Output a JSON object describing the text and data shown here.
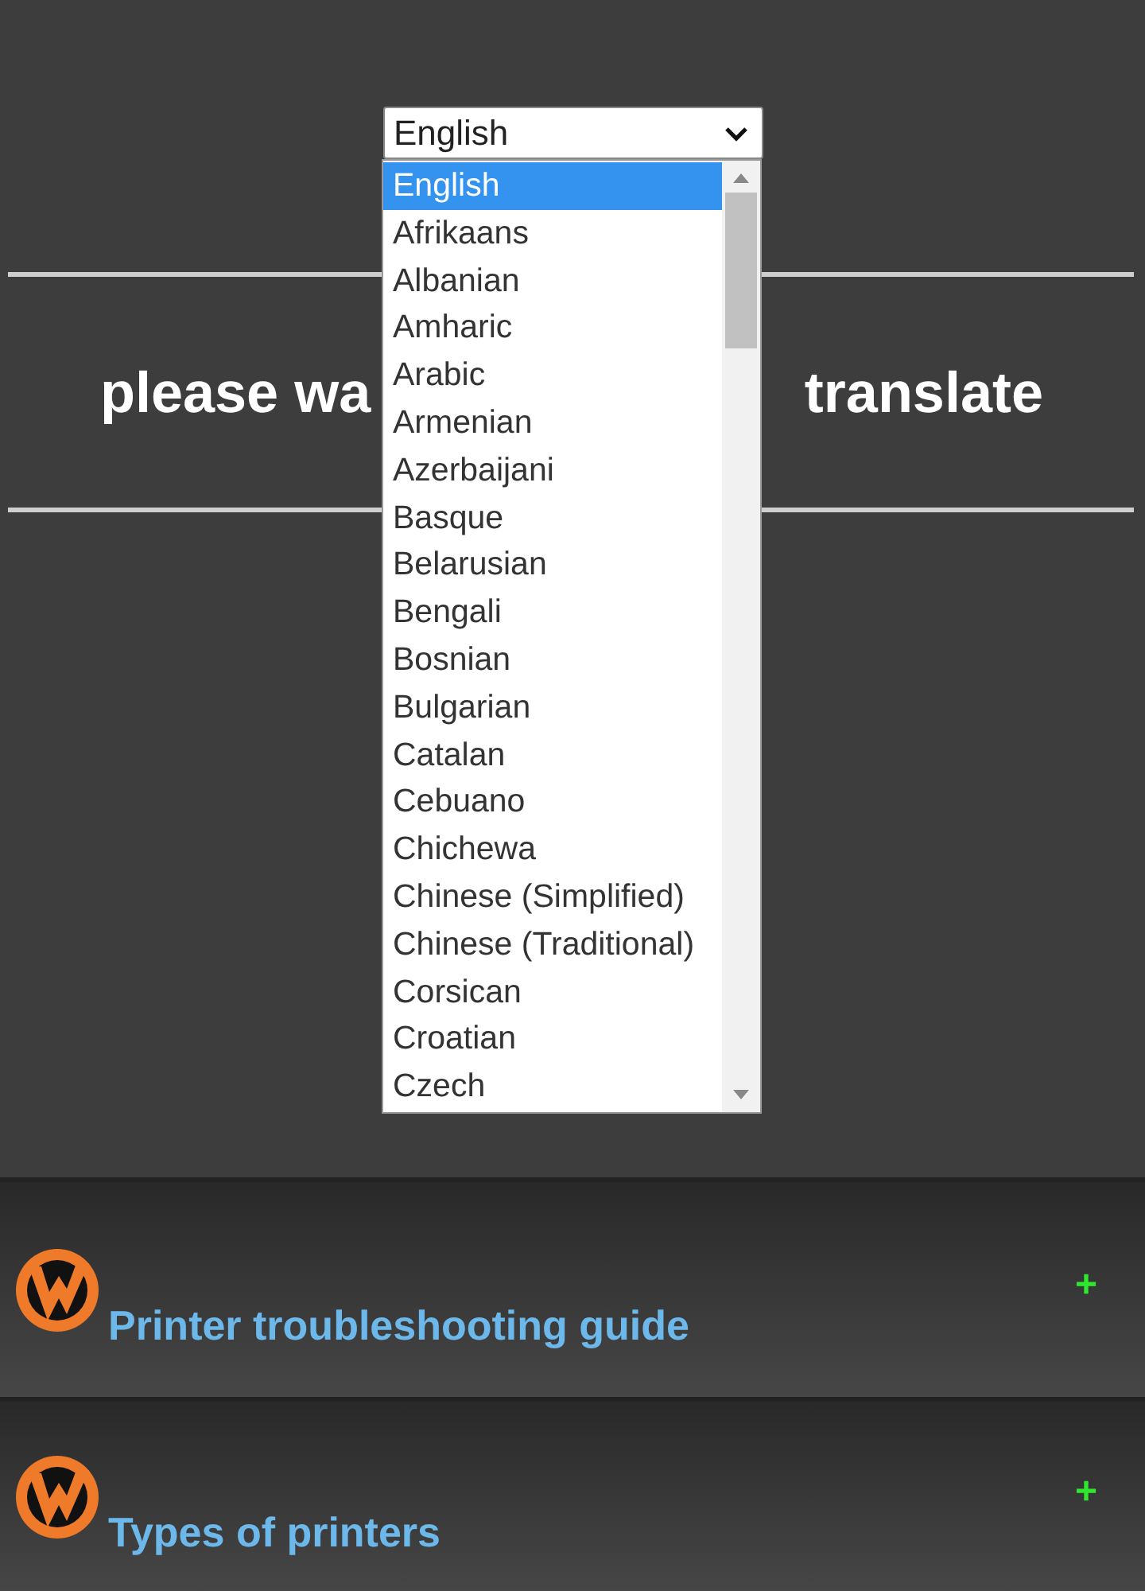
{
  "language_select": {
    "value": "English",
    "expanded": true,
    "options": [
      {
        "label": "English",
        "selected": true
      },
      {
        "label": "Afrikaans",
        "selected": false
      },
      {
        "label": "Albanian",
        "selected": false
      },
      {
        "label": "Amharic",
        "selected": false
      },
      {
        "label": "Arabic",
        "selected": false
      },
      {
        "label": "Armenian",
        "selected": false
      },
      {
        "label": "Azerbaijani",
        "selected": false
      },
      {
        "label": "Basque",
        "selected": false
      },
      {
        "label": "Belarusian",
        "selected": false
      },
      {
        "label": "Bengali",
        "selected": false
      },
      {
        "label": "Bosnian",
        "selected": false
      },
      {
        "label": "Bulgarian",
        "selected": false
      },
      {
        "label": "Catalan",
        "selected": false
      },
      {
        "label": "Cebuano",
        "selected": false
      },
      {
        "label": "Chichewa",
        "selected": false
      },
      {
        "label": "Chinese (Simplified)",
        "selected": false
      },
      {
        "label": "Chinese (Traditional)",
        "selected": false
      },
      {
        "label": "Corsican",
        "selected": false
      },
      {
        "label": "Croatian",
        "selected": false
      },
      {
        "label": "Czech",
        "selected": false
      }
    ]
  },
  "heading": {
    "left_part": "please wa",
    "right_part": "translate"
  },
  "sections": [
    {
      "title": "Printer troubleshooting guide",
      "toggle": "+"
    },
    {
      "title": "Types of printers",
      "toggle": "+"
    }
  ]
}
